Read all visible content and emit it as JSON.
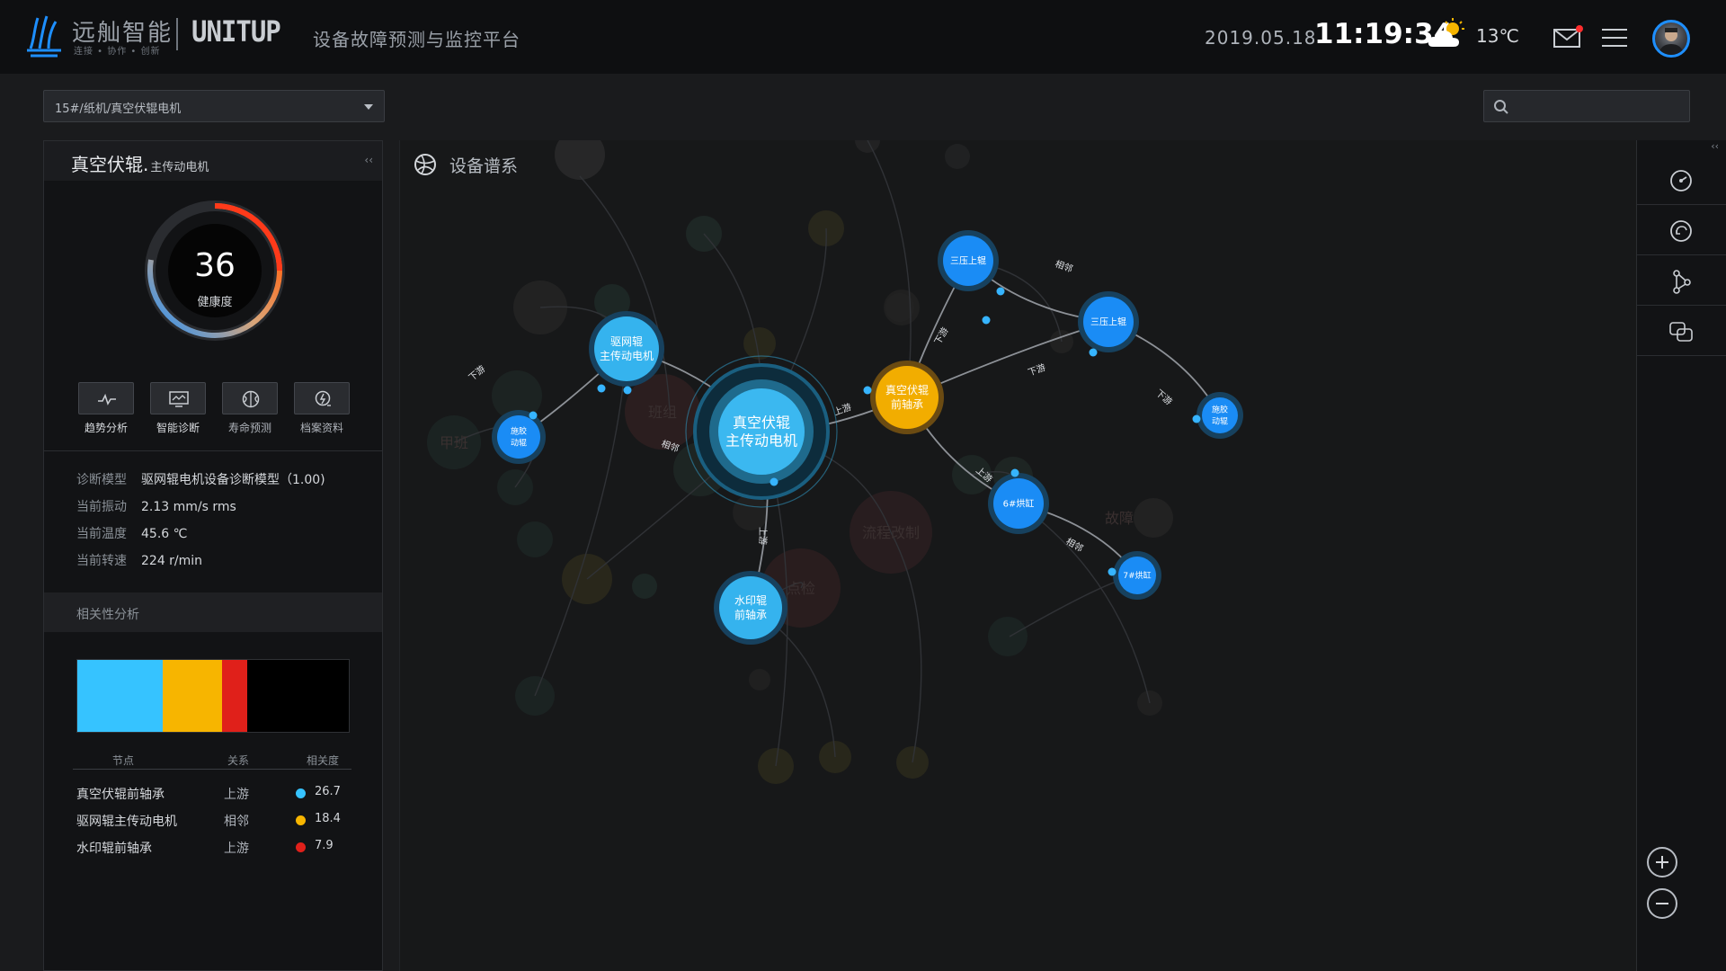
{
  "header": {
    "brand_cn": "远舢智能",
    "brand_sub": "连接 • 协作 • 创新",
    "brand_en": "UNITUP",
    "platform": "设备故障预测与监控平台",
    "date": "2019.05.18",
    "time": "11:19:34",
    "temperature": "13℃",
    "notification_color": "#ff2d2d"
  },
  "toolbar": {
    "device_path": "15#/纸机/真空伏辊电机",
    "search_placeholder": ""
  },
  "device_panel": {
    "title": "真空伏辊.",
    "subtitle": "主传动电机",
    "collapse": "‹‹",
    "health_score": "36",
    "health_label": "健康度",
    "tools": [
      {
        "label": "趋势分析",
        "icon": "trend-icon"
      },
      {
        "label": "智能诊断",
        "icon": "monitor-icon"
      },
      {
        "label": "寿命预测",
        "icon": "brain-icon"
      },
      {
        "label": "档案资料",
        "icon": "archive-icon"
      }
    ],
    "metrics": [
      {
        "key": "诊断模型",
        "value": "驱网辊电机设备诊断模型（1.00)"
      },
      {
        "key": "当前振动",
        "value": "2.13 mm/s rms"
      },
      {
        "key": "当前温度",
        "value": "45.6 ℃"
      },
      {
        "key": "当前转速",
        "value": "224 r/min"
      }
    ],
    "correlation": {
      "title": "相关性分析",
      "headers": [
        "节点",
        "关系",
        "相关度"
      ],
      "rows": [
        {
          "node": "真空伏辊前轴承",
          "relation": "上游",
          "value": "26.7",
          "color": "#36c3ff"
        },
        {
          "node": "驱网辊主传动电机",
          "relation": "相邻",
          "value": "18.4",
          "color": "#f7b500"
        },
        {
          "node": "水印辊前轴承",
          "relation": "上游",
          "value": "7.9",
          "color": "#e0201a"
        }
      ]
    }
  },
  "graph": {
    "title": "设备谱系",
    "nodes": [
      {
        "id": "center",
        "lines": [
          "真空伏辊",
          "主传动电机"
        ],
        "type": "center"
      },
      {
        "id": "qwg",
        "lines": [
          "驱网辊",
          "主传动电机"
        ],
        "type": "light"
      },
      {
        "id": "sj",
        "lines": [
          "施胶",
          "动辊"
        ],
        "type": "blue"
      },
      {
        "id": "syg",
        "lines": [
          "水印辊",
          "前轴承"
        ],
        "type": "light"
      },
      {
        "id": "zkq",
        "lines": [
          "真空伏辊",
          "前轴承"
        ],
        "type": "orange"
      },
      {
        "id": "syshang1",
        "lines": [
          "三压上辊"
        ],
        "type": "blue"
      },
      {
        "id": "syshang2",
        "lines": [
          "三压上辊"
        ],
        "type": "blue"
      },
      {
        "id": "sj2",
        "lines": [
          "施胶",
          "动辊"
        ],
        "type": "blue"
      },
      {
        "id": "hg6",
        "lines": [
          "6#烘缸"
        ],
        "type": "blue"
      },
      {
        "id": "hg7",
        "lines": [
          "7#烘缸"
        ],
        "type": "blue"
      }
    ],
    "edges": [
      {
        "from": "sj",
        "to": "qwg",
        "label": "下游"
      },
      {
        "from": "qwg",
        "to": "center",
        "label": "相邻"
      },
      {
        "from": "center",
        "to": "zkq",
        "label": "上游"
      },
      {
        "from": "center",
        "to": "syg",
        "label": "上游"
      },
      {
        "from": "zkq",
        "to": "syshang1",
        "label": "下游"
      },
      {
        "from": "zkq",
        "to": "syshang2",
        "label": "下游"
      },
      {
        "from": "syshang1",
        "to": "syshang2",
        "label": "相邻"
      },
      {
        "from": "syshang2",
        "to": "sj2",
        "label": "下游"
      },
      {
        "from": "zkq",
        "to": "hg6",
        "label": "上游"
      },
      {
        "from": "hg6",
        "to": "hg7",
        "label": "相邻"
      }
    ],
    "ghost_labels": [
      "甲班",
      "班组",
      "流程改制",
      "故障",
      "点检"
    ]
  },
  "rail": {
    "collapse": "‹‹",
    "buttons": [
      "dashboard-icon",
      "refresh-icon",
      "graph-icon",
      "compare-icon"
    ]
  },
  "colors": {
    "center": "#3bb8f0",
    "light": "#35b3ee",
    "blue": "#1a8cf5",
    "orange": "#f2ad00"
  }
}
